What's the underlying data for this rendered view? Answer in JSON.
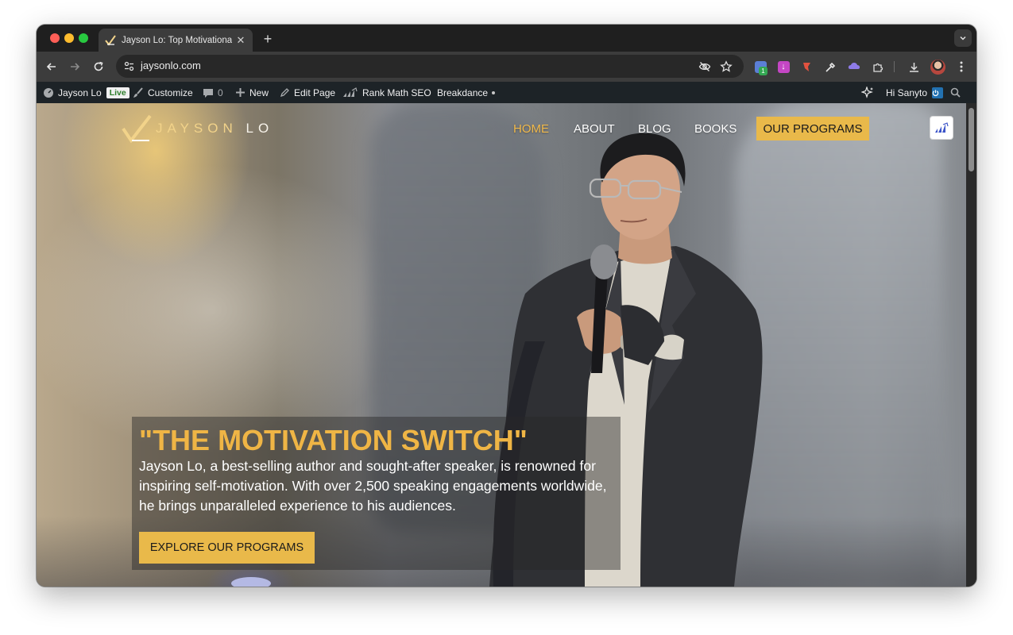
{
  "browser": {
    "tab_title": "Jayson Lo: Top Motivational S",
    "url": "jaysonlo.com",
    "extension_badge": "1"
  },
  "admin_bar": {
    "site_name": "Jayson Lo",
    "live_label": "Live",
    "customize": "Customize",
    "comments_count": "0",
    "new": "New",
    "edit_page": "Edit Page",
    "rank_math": "Rank Math SEO",
    "breakdance": "Breakdance",
    "greeting": "Hi Sanyto"
  },
  "site": {
    "logo_main": "JAYSON",
    "logo_accent": "LO",
    "nav": {
      "home": "HOME",
      "about": "ABOUT",
      "blog": "BLOG",
      "books": "BOOKS",
      "programs": "OUR PROGRAMS"
    }
  },
  "hero": {
    "title": "\"THE MOTIVATION SWITCH\"",
    "description": "Jayson Lo, a best-selling author and sought-after speaker, is renowned for inspiring self-motivation. With over 2,500 speaking engagements worldwide, he brings unparalleled experience to his audiences.",
    "button": "EXPLORE OUR PROGRAMS"
  },
  "colors": {
    "accent": "#e9b94a",
    "title_gold": "#efb545",
    "admin_bar": "#1d2327",
    "browser_chrome": "#3c3c3c"
  },
  "icons": {
    "tab_favicon": "jayson-lo-logo-icon",
    "back": "back-arrow-icon",
    "forward": "forward-arrow-icon",
    "reload": "reload-icon",
    "site_info": "site-settings-icon",
    "hide": "eye-off-icon",
    "bookmark": "star-icon",
    "download": "download-icon",
    "menu": "kebab-menu-icon",
    "sparkle": "sparkle-icon",
    "search": "search-icon"
  }
}
